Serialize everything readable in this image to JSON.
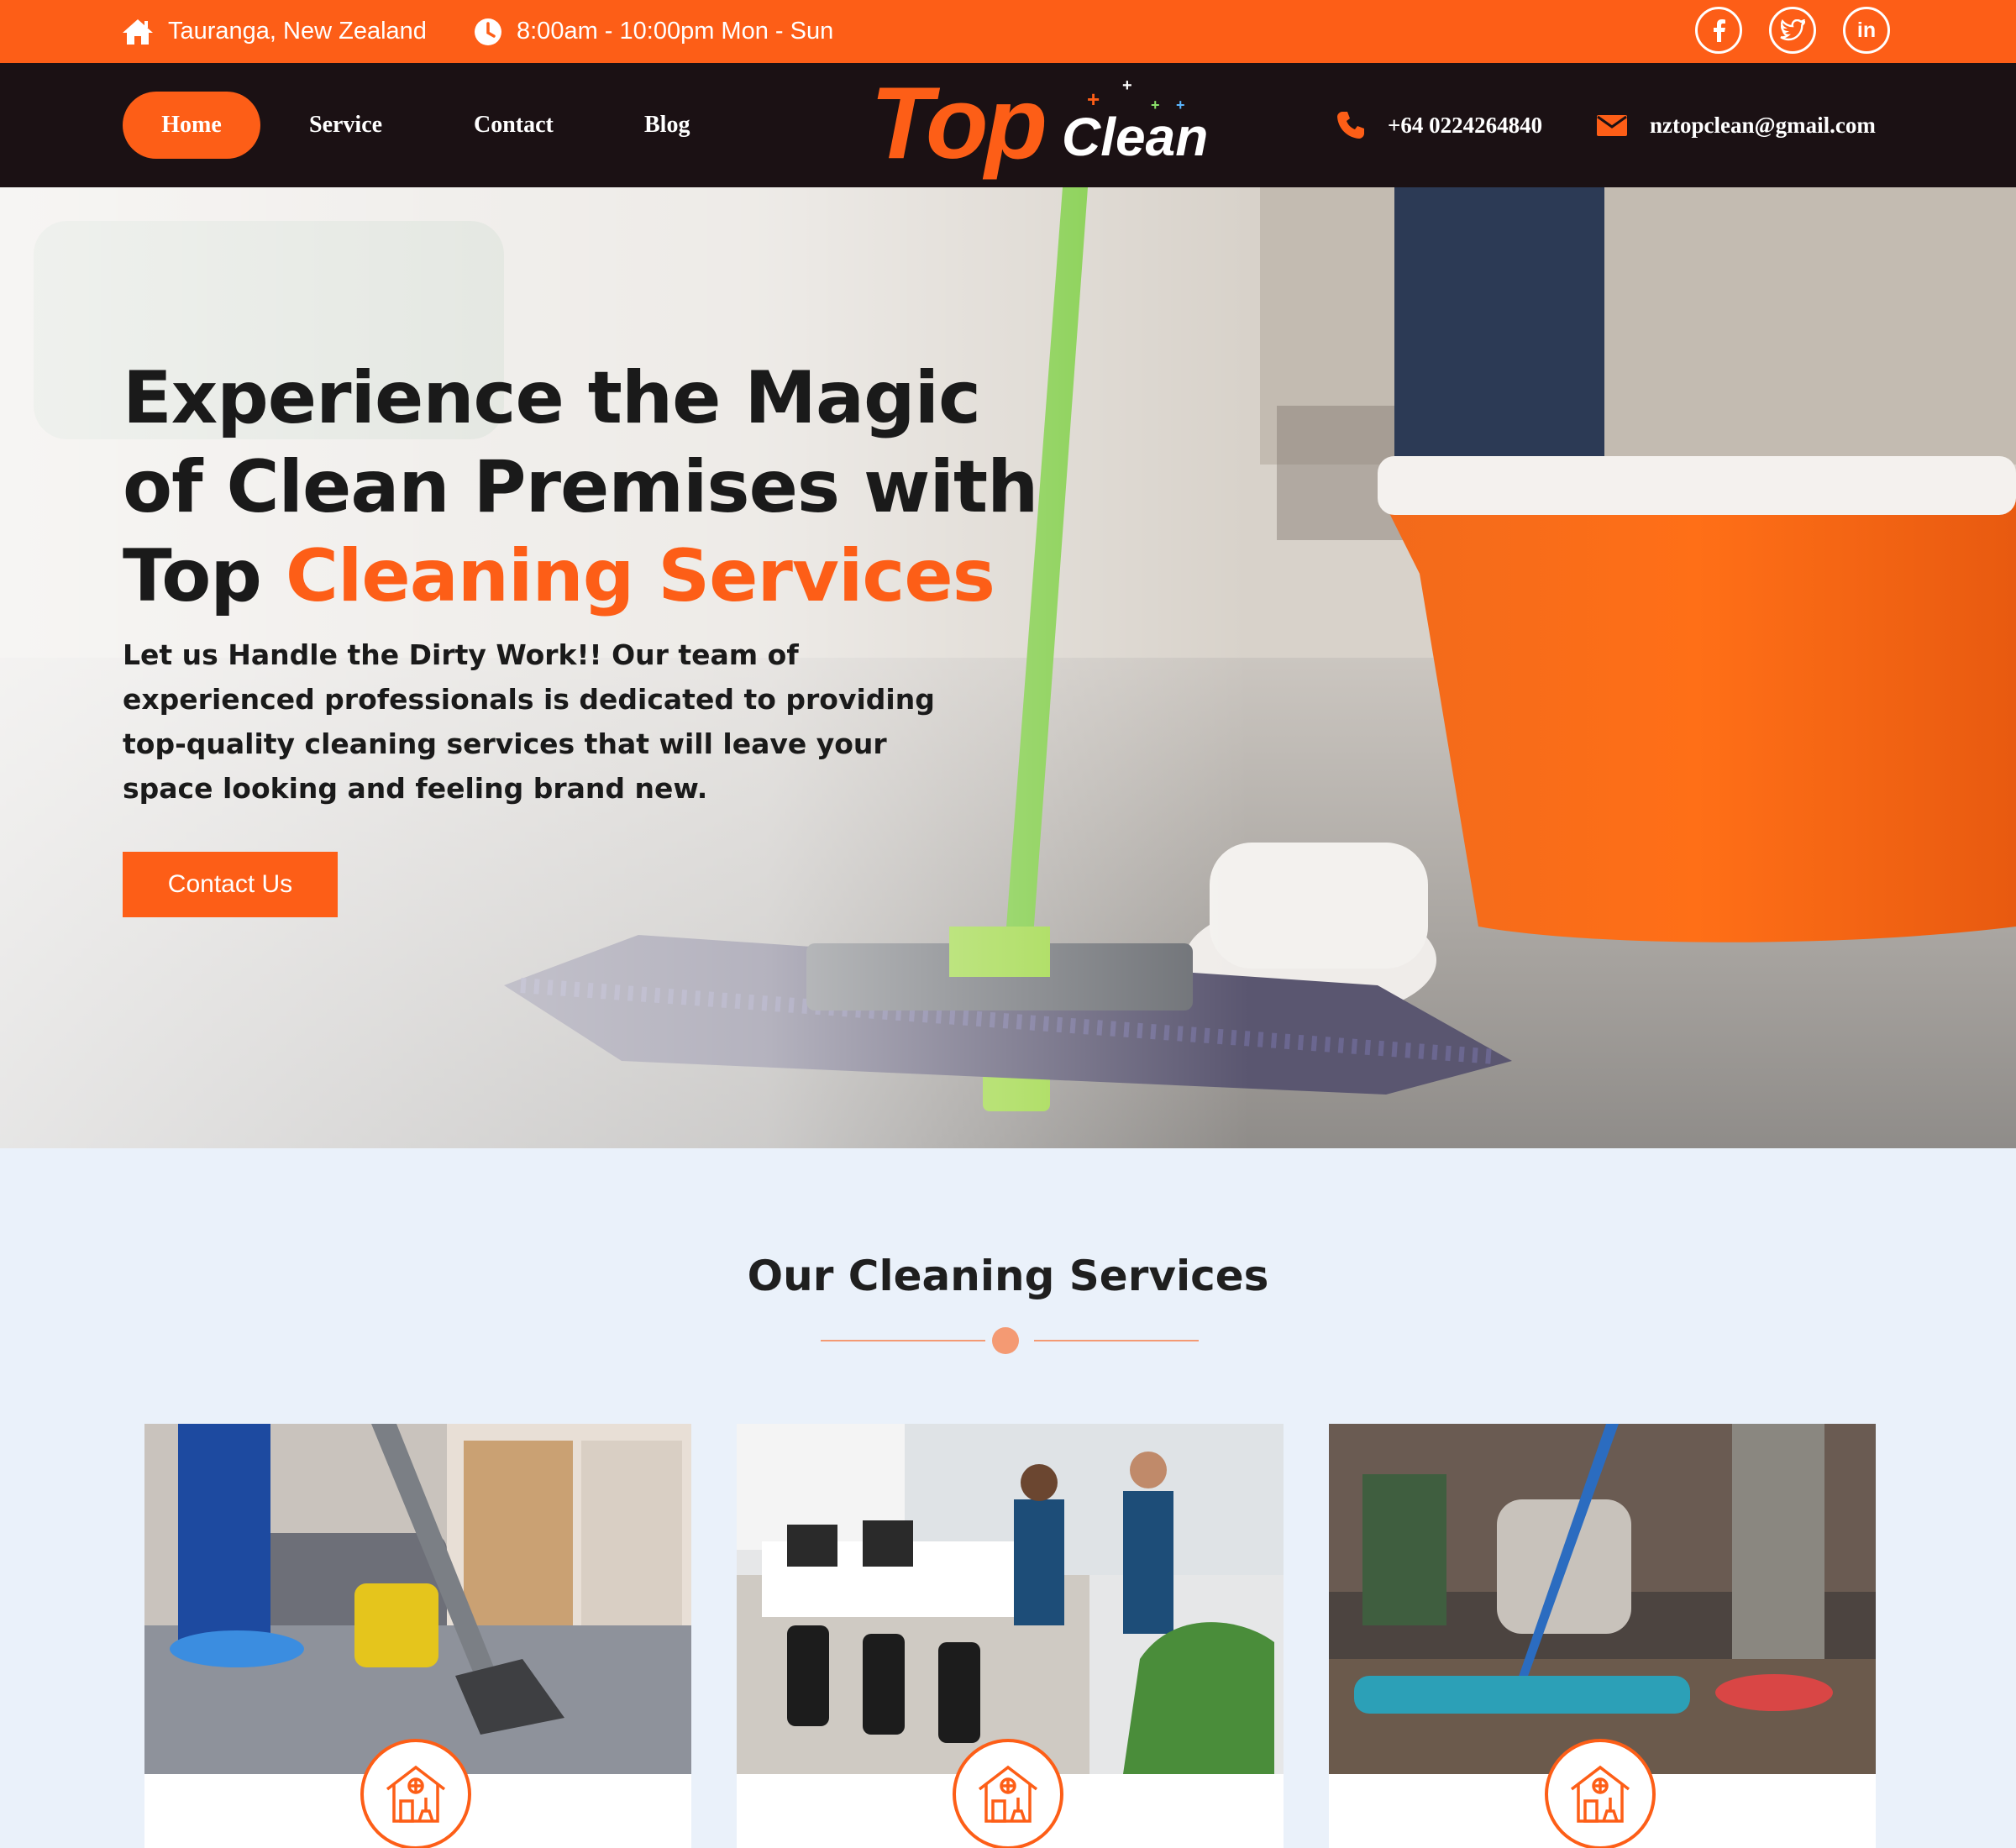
{
  "topbar": {
    "location": "Tauranga, New Zealand",
    "hours": "8:00am - 10:00pm Mon - Sun",
    "social": [
      {
        "icon": "facebook-icon",
        "glyph": "f"
      },
      {
        "icon": "twitter-icon",
        "glyph": "t"
      },
      {
        "icon": "linkedin-icon",
        "glyph": "in"
      }
    ]
  },
  "nav": {
    "items": [
      "Home",
      "Service",
      "Contact",
      "Blog"
    ],
    "active": "Home"
  },
  "logo": {
    "top": "Top",
    "clean": "Clean"
  },
  "contact": {
    "phone": "+64 0224264840",
    "email": "nztopclean@gmail.com"
  },
  "hero": {
    "heading_line1": "Experience the Magic",
    "heading_line2": "of Clean Premises with",
    "heading_line3_plain": "Top ",
    "heading_line3_accent": "Cleaning Services",
    "text": "Let us Handle the Dirty Work!! Our team of experienced professionals is dedicated to providing top-quality cleaning services that will leave your space looking and feeling brand new.",
    "button": "Contact Us"
  },
  "services": {
    "title": "Our Cleaning Services"
  },
  "colors": {
    "accent": "#fd5e17",
    "nav_bg": "#1b1114",
    "page_bg": "#eaf1fa"
  }
}
